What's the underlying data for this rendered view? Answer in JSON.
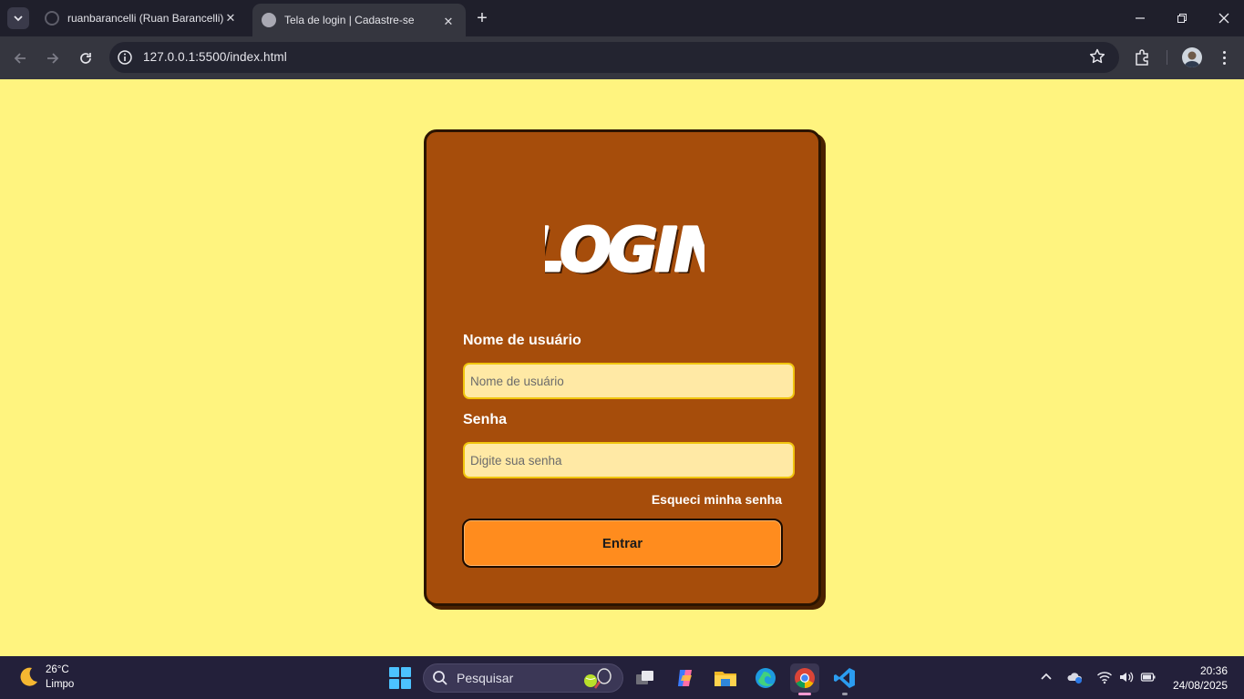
{
  "browser": {
    "tabs": [
      {
        "title": "ruanbarancelli (Ruan Barancelli)",
        "active": false
      },
      {
        "title": "Tela de login | Cadastre-se",
        "active": true
      }
    ],
    "url": "127.0.0.1:5500/index.html"
  },
  "login": {
    "heading": "LOGIN",
    "username_label": "Nome de usuário",
    "username_placeholder": "Nome de usuário",
    "username_value": "",
    "password_label": "Senha",
    "password_placeholder": "Digite sua senha",
    "password_value": "",
    "forgot_link": "Esqueci minha senha",
    "submit_label": "Entrar"
  },
  "colors": {
    "page_background": "#fff47f",
    "card_background": "#a64d0b",
    "input_background": "#ffe9a5",
    "input_border": "#f1c50e",
    "button_background": "#ff8c1e"
  },
  "taskbar": {
    "weather_temp": "26°C",
    "weather_condition": "Limpo",
    "search_placeholder": "Pesquisar",
    "apps": [
      "task-view-icon",
      "copilot-icon",
      "file-explorer-icon",
      "edge-icon",
      "chrome-icon",
      "vscode-icon"
    ],
    "time": "20:36",
    "date": "24/08/2025"
  }
}
